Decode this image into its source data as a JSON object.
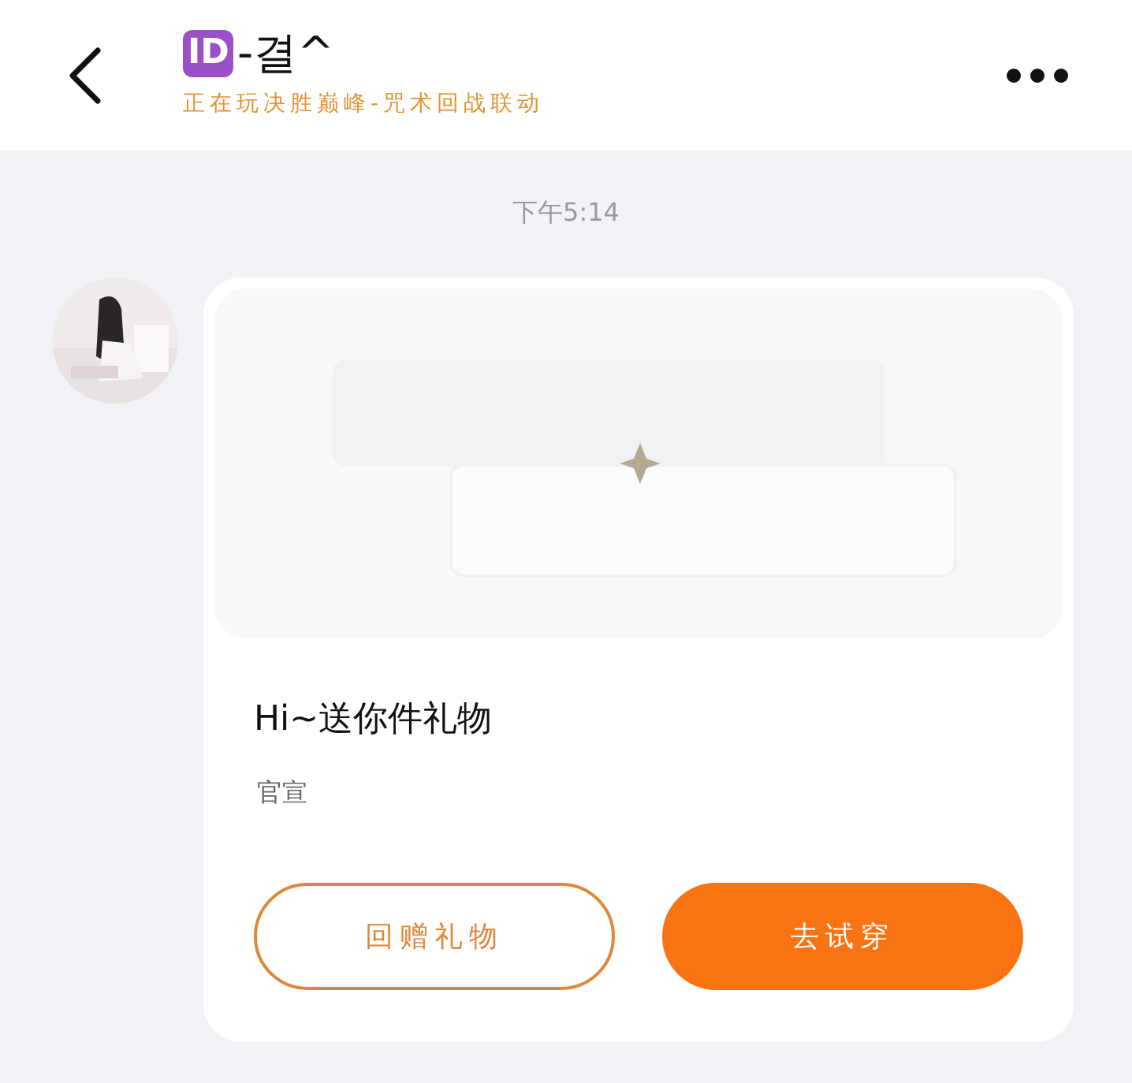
{
  "header": {
    "badge": "ID",
    "title": "-결^",
    "subtitle": "正在玩决胜巅峰-咒术回战联动"
  },
  "chat": {
    "time": "下午5:14",
    "message": {
      "heading": "Hi~送你件礼物",
      "note": "官宣",
      "buttons": [
        {
          "label": "回赠礼物",
          "kind": "outline"
        },
        {
          "label": "去试穿",
          "kind": "filled"
        }
      ]
    }
  }
}
